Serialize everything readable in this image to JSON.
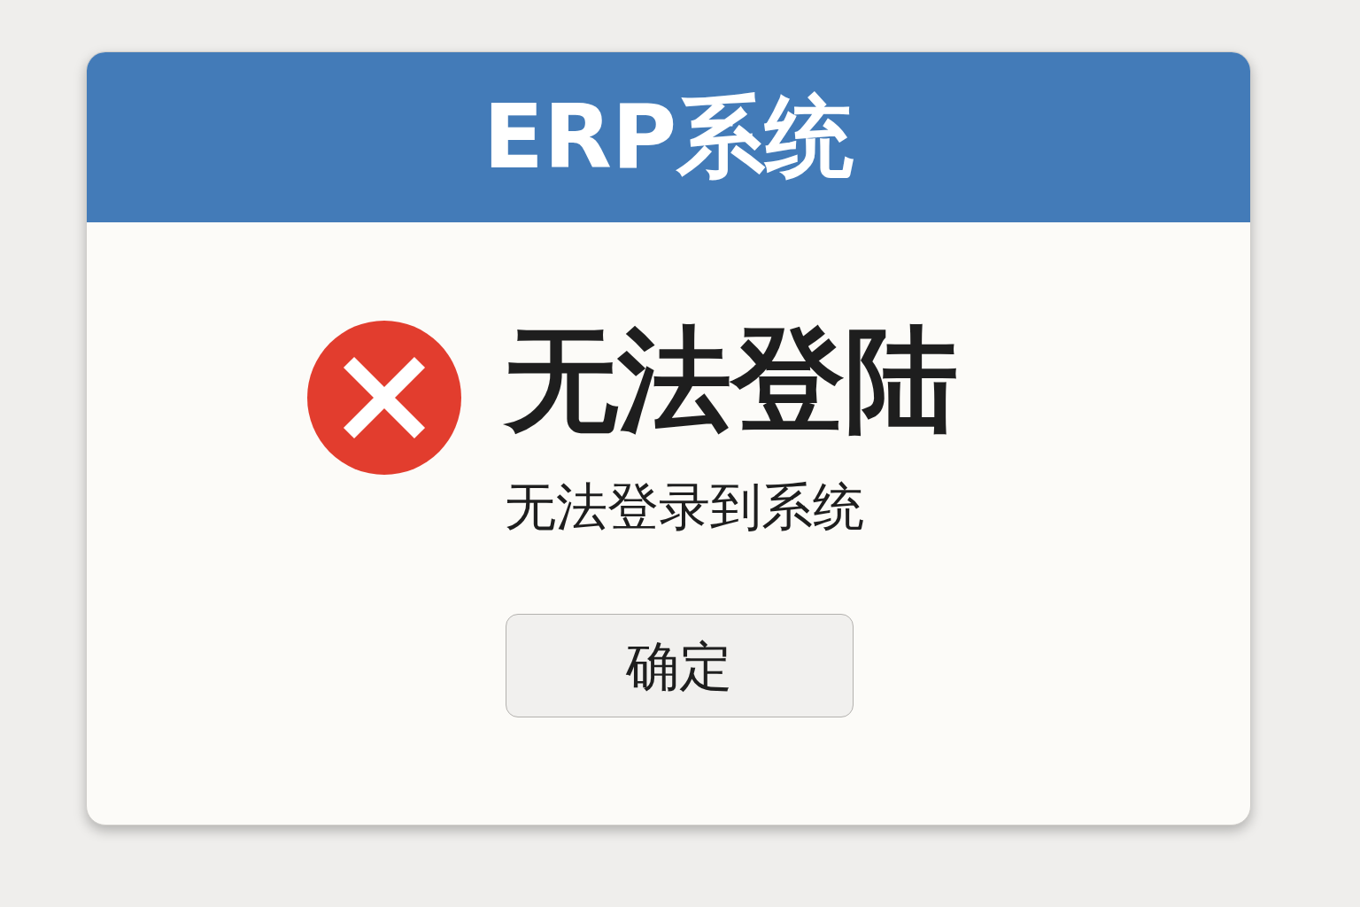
{
  "dialog": {
    "title": "ERP系统",
    "icon": {
      "kind": "error"
    },
    "heading": "无法登陆",
    "message": "无法登录到系统",
    "buttons": [
      "确定"
    ]
  }
}
